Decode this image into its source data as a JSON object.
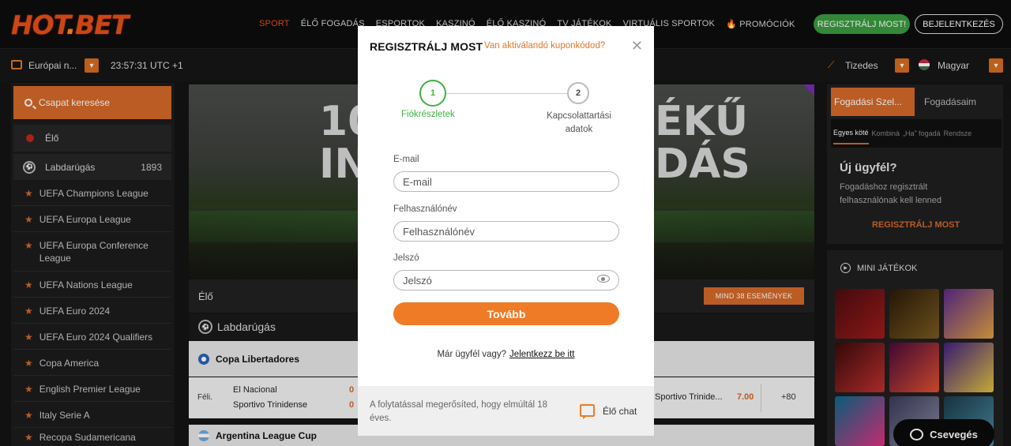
{
  "brand": {
    "name_a": "HOT",
    "name_dot": ".",
    "name_b": "BET"
  },
  "nav": {
    "items": [
      {
        "label": "SPORT"
      },
      {
        "label": "ÉLŐ FOGADÁS"
      },
      {
        "label": "ESPORTOK"
      },
      {
        "label": "KASZINÓ"
      },
      {
        "label": "ÉLŐ KASZINÓ"
      },
      {
        "label": "TV JÁTÉKOK"
      },
      {
        "label": "VIRTUÁLIS SPORTOK"
      },
      {
        "label": "PROMÓCIÓK"
      }
    ]
  },
  "header": {
    "register": "REGISZTRÁLJ MOST!",
    "login": "BEJELENTKEZÉS"
  },
  "subbar": {
    "odds_format": "Európai n...",
    "time": "23:57:31 UTC +1",
    "decimal": "Tizedes",
    "language": "Magyar",
    "chevron": "▾"
  },
  "sidebar": {
    "search_placeholder": "Csapat keresése",
    "live_label": "Élő",
    "sport": {
      "label": "Labdarúgás",
      "count": "1893"
    },
    "leagues": [
      "UEFA Champions League",
      "UEFA Europa League",
      "UEFA Europa Conference League",
      "UEFA Nations League",
      "UEFA Euro 2024",
      "UEFA Euro 2024 Qualifiers",
      "Copa America",
      "English Premier League",
      "Italy Serie A",
      "Recopa Sudamericana"
    ]
  },
  "banner": {
    "text_left_1": "10",
    "text_left_2": "IN",
    "text_right_1": "ÉKŰ",
    "text_right_2": "DÁS"
  },
  "live": {
    "label": "Élő",
    "all_events": "MIND 38 ESEMÉNYEK"
  },
  "sport_section": {
    "label": "Labdarúgás"
  },
  "competitions": [
    {
      "name": "Copa Libertadores"
    },
    {
      "name": "Argentina League Cup"
    }
  ],
  "match": {
    "period": "Féli.",
    "team1": "El Nacional",
    "team2": "Sportivo Trinidense",
    "score1": "0",
    "score2": "0",
    "opponent": "Sportivo Trinide...",
    "odd": "7.00",
    "more": "+80"
  },
  "betslip": {
    "tab_active": "Fogadási Szel...",
    "tab_other": "Fogadásaim",
    "sub_tabs": [
      "Egyes köté",
      "Kombinà",
      "„Ha” fogadá",
      "Rendsze"
    ],
    "title": "Új ügyfél?",
    "desc": "Fogadáshoz regisztrált felhasználónak kell lenned",
    "register": "REGISZTRÁLJ MOST"
  },
  "mini_games": {
    "title": "MINI JÁTÉKOK"
  },
  "chat": {
    "label": "Csevegés"
  },
  "modal": {
    "title": "REGISZTRÁLJ MOST",
    "coupon_link": "Van aktiválandó kuponkódod?",
    "close": "✕",
    "steps": [
      {
        "number": "1",
        "label": "Fiókrészletek"
      },
      {
        "number": "2",
        "label": "Kapcsolattartási adatok"
      }
    ],
    "fields": {
      "email": {
        "label": "E-mail",
        "placeholder": "E-mail",
        "value": ""
      },
      "username": {
        "label": "Felhasználónév",
        "placeholder": "Felhasználónév",
        "value": ""
      },
      "password": {
        "label": "Jelszó",
        "placeholder": "Jelszó",
        "value": ""
      }
    },
    "next_button": "Tovább",
    "already_customer": "Már ügyfél vagy?",
    "login_link": "Jelentkezz be itt",
    "age_note": "A folytatással megerősíted, hogy elmúltál 18 éves.",
    "live_chat": "Élő chat"
  },
  "colors": {
    "accent": "#ef7b26",
    "brand": "#e8501a",
    "success": "#3fb23f",
    "register_green": "#3a9b3e"
  }
}
